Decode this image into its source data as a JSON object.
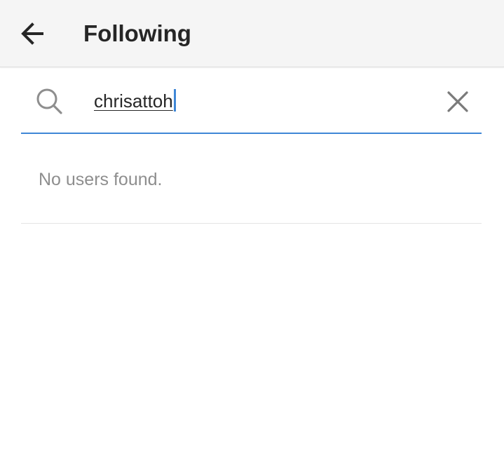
{
  "header": {
    "title": "Following",
    "back_icon": "arrow-left-icon"
  },
  "search": {
    "value": "chrisattoh",
    "search_icon": "search-icon",
    "clear_icon": "close-icon",
    "accent_color": "#3f87d6"
  },
  "results": {
    "empty_message": "No users found."
  }
}
